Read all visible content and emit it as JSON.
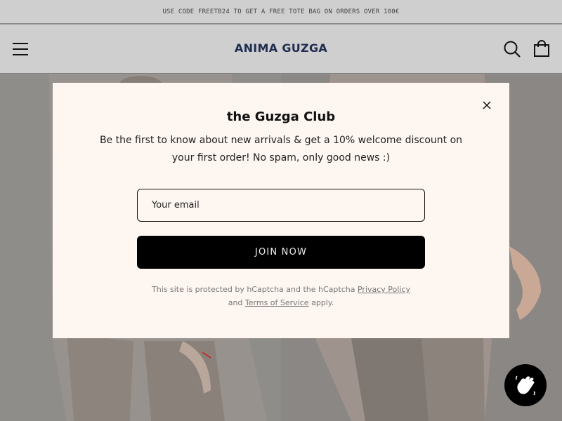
{
  "announcement": {
    "text": "USE CODE FREETB24 TO GET A FREE TOTE BAG ON ORDERS OVER 100€"
  },
  "header": {
    "logo": "ANIMA GUZGA",
    "menu_icon": "menu-icon",
    "search_icon": "search-icon",
    "cart_icon": "shopping-bag-icon"
  },
  "popup": {
    "title": "the Guzga Club",
    "description": "Be the first to know about new arrivals & get a 10% welcome discount on your first order! No spam, only good news :)",
    "email_placeholder": "Your email",
    "submit_label": "JOIN NOW",
    "legal_prefix": "This site is protected by hCaptcha and the hCaptcha",
    "privacy_link": "Privacy Policy",
    "legal_and": "and",
    "terms_link": "Terms of Service",
    "legal_suffix": "apply.",
    "close_icon": "close-icon"
  },
  "chat": {
    "icon": "waving-hand-icon"
  },
  "colors": {
    "overlay_bg": "#cfcfcf",
    "logo": "#1f2d4f",
    "modal_bg": "#fdf6f1",
    "button_bg": "#000000"
  }
}
